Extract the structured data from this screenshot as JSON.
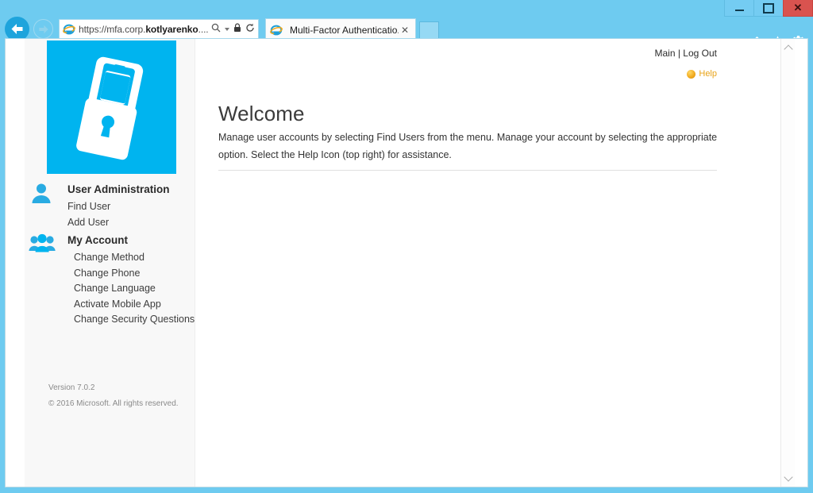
{
  "browser": {
    "window_controls": {
      "minimize_label": "–",
      "maximize_label": "□",
      "close_label": "✕"
    },
    "back_button_label": "Back",
    "forward_button_label": "Forward",
    "address": {
      "url_prefix": "https://mfa.corp.",
      "url_host": "kotlyarenko",
      "url_suffix": "....",
      "search_icon": "search-icon",
      "dropdown_icon": "chevron-down-icon",
      "lock_icon": "🔒",
      "refresh_icon": "↻"
    },
    "tab": {
      "title": "Multi-Factor Authenticatio...",
      "close_label": "✕",
      "favicon": "internet-explorer-icon"
    },
    "new_tab_label": "",
    "toolbar_icons": [
      {
        "name": "home-icon"
      },
      {
        "name": "favorites-star-icon"
      },
      {
        "name": "settings-gear-icon"
      }
    ]
  },
  "page": {
    "top_links": "Main | Log Out",
    "help": {
      "label": "Help",
      "icon": "help-circle-icon"
    },
    "welcome": {
      "title": "Welcome",
      "body": "Manage user accounts by selecting Find Users from the menu. Manage your account by selecting the appropriate option. Select the Help Icon (top right) for assistance."
    },
    "sidebar": {
      "logo": {
        "name": "phone-lock-logo",
        "background": "#00B4EF"
      },
      "groups": [
        {
          "heading": "User Administration",
          "icon": "single-user-icon",
          "items": [
            {
              "label": "Find User"
            },
            {
              "label": "Add User"
            }
          ]
        },
        {
          "heading": "My Account",
          "icon": "user-group-icon",
          "items": [
            {
              "label": "Change Method"
            },
            {
              "label": "Change Phone"
            },
            {
              "label": "Change Language"
            },
            {
              "label": "Activate Mobile App"
            },
            {
              "label": "Change Security Questions"
            }
          ]
        }
      ],
      "version": "Version 7.0.2",
      "copyright": "© 2016 Microsoft. All rights reserved."
    },
    "scrollbar": {
      "up_label": "scroll-up",
      "down_label": "scroll-down"
    }
  },
  "colors": {
    "brand_cyan": "#00B4EF",
    "chrome_blue": "#6ECBF0",
    "close_red": "#D9534F",
    "help_orange": "#E8A317",
    "sidebar_bg": "#F8F8F8"
  }
}
